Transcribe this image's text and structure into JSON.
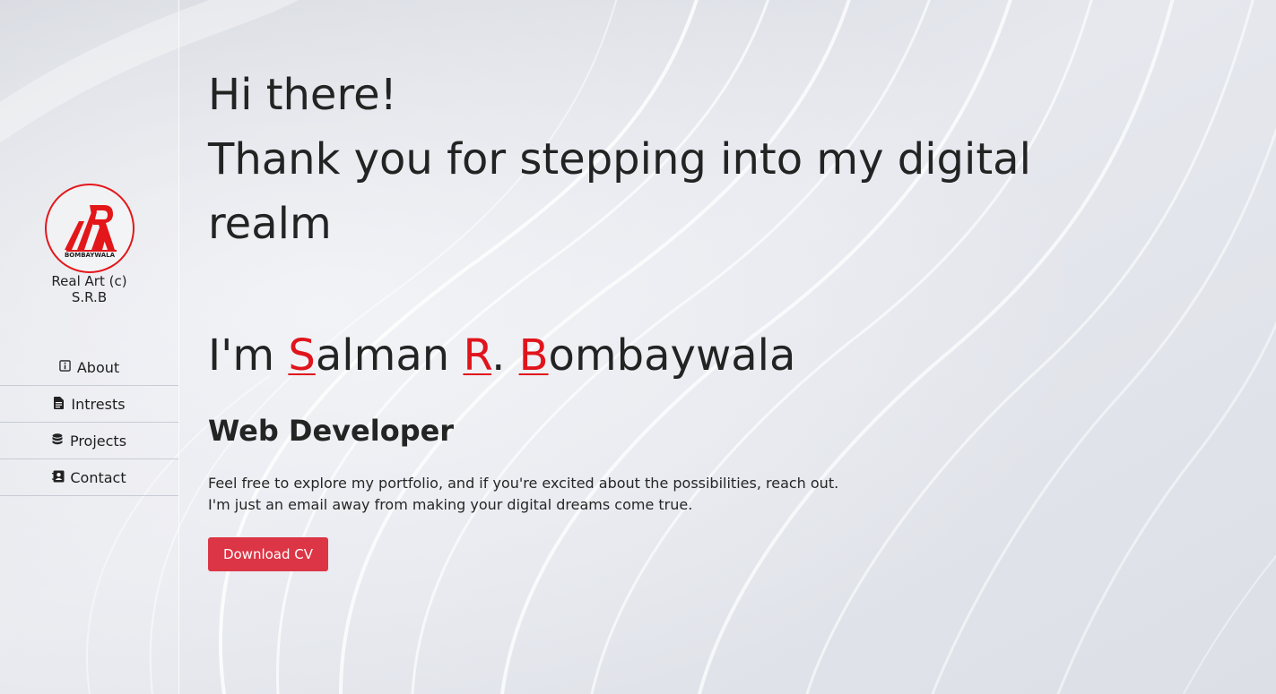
{
  "brand": {
    "logo_text": "BOMBAYWALA",
    "line1": "Real Art (c)",
    "line2": "S.R.B"
  },
  "nav": [
    {
      "label": "About",
      "icon": "info-square-icon"
    },
    {
      "label": "Intrests",
      "icon": "file-text-icon"
    },
    {
      "label": "Projects",
      "icon": "database-icon"
    },
    {
      "label": "Contact",
      "icon": "address-book-icon"
    }
  ],
  "hero": {
    "greeting_line1": "Hi there!",
    "greeting_line2": "Thank you for stepping into my digital realm",
    "name_prefix": "I'm ",
    "name_initial1": "S",
    "name_rest1": "alman ",
    "name_initial2": "R",
    "name_rest2": ". ",
    "name_initial3": "B",
    "name_rest3": "ombaywala",
    "role": "Web Developer",
    "desc_line1": "Feel free to explore my portfolio, and if you're excited about the possibilities, reach out.",
    "desc_line2": "I'm just an email away from making your digital dreams come true.",
    "cv_button": "Download CV"
  },
  "colors": {
    "accent": "#e0141c",
    "button": "#dc3545",
    "background": "#e4e6ec"
  }
}
